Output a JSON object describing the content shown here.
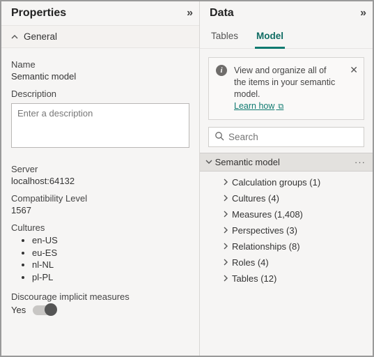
{
  "properties": {
    "title": "Properties",
    "section_general": "General",
    "labels": {
      "name": "Name",
      "description": "Description",
      "server": "Server",
      "compat": "Compatibility Level",
      "cultures": "Cultures",
      "discourage": "Discourage implicit measures"
    },
    "values": {
      "name": "Semantic model",
      "description_placeholder": "Enter a description",
      "server": "localhost:64132",
      "compat": "1567",
      "cultures": [
        "en-US",
        "eu-ES",
        "nl-NL",
        "pl-PL"
      ],
      "discourage_state": "Yes"
    }
  },
  "data": {
    "title": "Data",
    "tabs": {
      "tables": "Tables",
      "model": "Model"
    },
    "info": {
      "text": "View and organize all of the items in your semantic model.",
      "link": "Learn how"
    },
    "search_placeholder": "Search",
    "tree_root": "Semantic model",
    "tree": [
      {
        "label": "Calculation groups",
        "count": 1
      },
      {
        "label": "Cultures",
        "count": 4
      },
      {
        "label": "Measures",
        "count": 1408
      },
      {
        "label": "Perspectives",
        "count": 3
      },
      {
        "label": "Relationships",
        "count": 8
      },
      {
        "label": "Roles",
        "count": 4
      },
      {
        "label": "Tables",
        "count": 12
      }
    ]
  }
}
